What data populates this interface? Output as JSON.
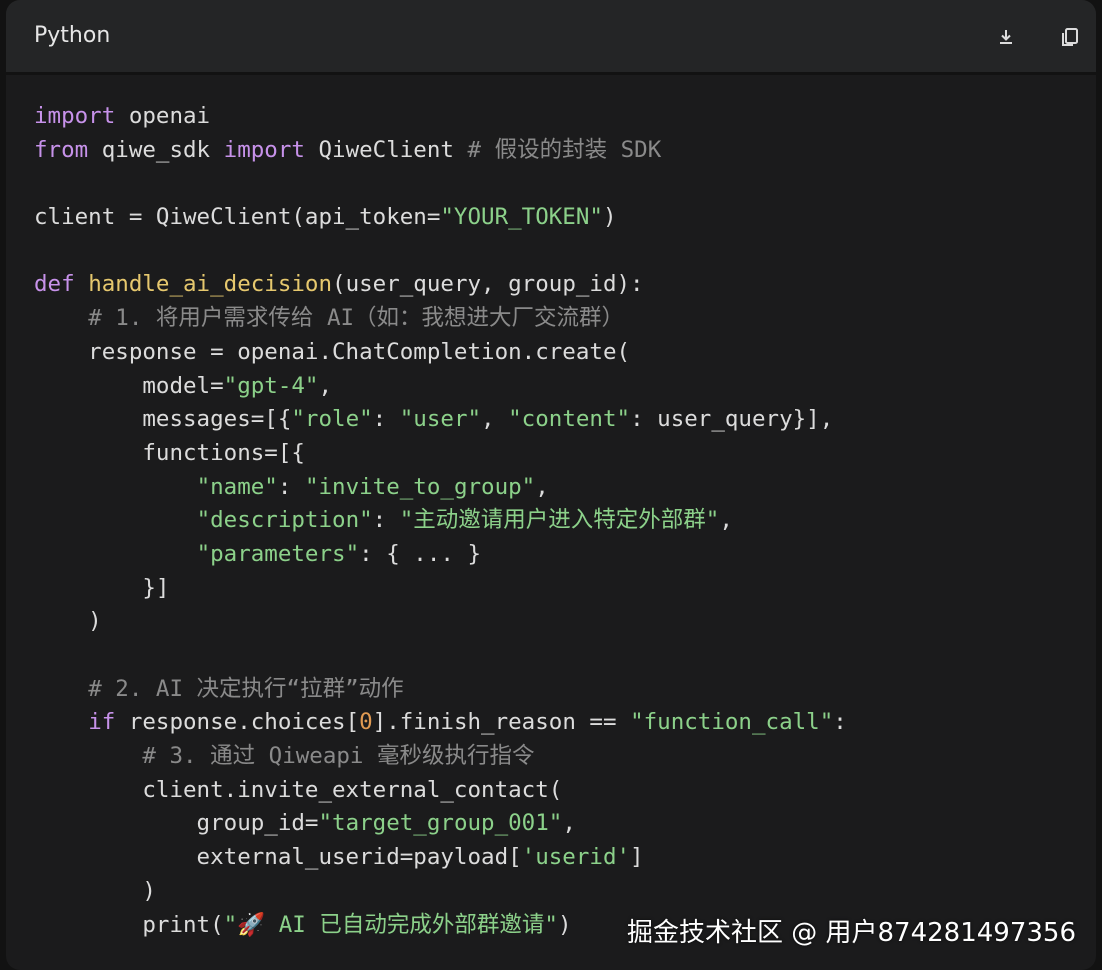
{
  "header": {
    "language": "Python",
    "download_icon": "download-icon",
    "copy_icon": "copy-icon"
  },
  "code_lines": [
    [
      {
        "c": "kw",
        "t": "import"
      },
      {
        "c": "pl",
        "t": " openai"
      }
    ],
    [
      {
        "c": "kw",
        "t": "from"
      },
      {
        "c": "pl",
        "t": " qiwe_sdk "
      },
      {
        "c": "kw",
        "t": "import"
      },
      {
        "c": "pl",
        "t": " QiweClient "
      },
      {
        "c": "cm",
        "t": "# 假设的封装 SDK"
      }
    ],
    [],
    [
      {
        "c": "pl",
        "t": "client = QiweClient(api_token="
      },
      {
        "c": "str",
        "t": "\"YOUR_TOKEN\""
      },
      {
        "c": "pl",
        "t": ")"
      }
    ],
    [],
    [
      {
        "c": "kw",
        "t": "def"
      },
      {
        "c": "pl",
        "t": " "
      },
      {
        "c": "fn",
        "t": "handle_ai_decision"
      },
      {
        "c": "pl",
        "t": "(user_query, group_id):"
      }
    ],
    [
      {
        "c": "pl",
        "t": "    "
      },
      {
        "c": "cm",
        "t": "# 1. 将用户需求传给 AI（如：我想进大厂交流群）"
      }
    ],
    [
      {
        "c": "pl",
        "t": "    response = openai.ChatCompletion.create("
      }
    ],
    [
      {
        "c": "pl",
        "t": "        model="
      },
      {
        "c": "str",
        "t": "\"gpt-4\""
      },
      {
        "c": "pl",
        "t": ","
      }
    ],
    [
      {
        "c": "pl",
        "t": "        messages=[{"
      },
      {
        "c": "str",
        "t": "\"role\""
      },
      {
        "c": "pl",
        "t": ": "
      },
      {
        "c": "str",
        "t": "\"user\""
      },
      {
        "c": "pl",
        "t": ", "
      },
      {
        "c": "str",
        "t": "\"content\""
      },
      {
        "c": "pl",
        "t": ": user_query}],"
      }
    ],
    [
      {
        "c": "pl",
        "t": "        functions=[{"
      }
    ],
    [
      {
        "c": "pl",
        "t": "            "
      },
      {
        "c": "str",
        "t": "\"name\""
      },
      {
        "c": "pl",
        "t": ": "
      },
      {
        "c": "str",
        "t": "\"invite_to_group\""
      },
      {
        "c": "pl",
        "t": ","
      }
    ],
    [
      {
        "c": "pl",
        "t": "            "
      },
      {
        "c": "str",
        "t": "\"description\""
      },
      {
        "c": "pl",
        "t": ": "
      },
      {
        "c": "str",
        "t": "\"主动邀请用户进入特定外部群\""
      },
      {
        "c": "pl",
        "t": ","
      }
    ],
    [
      {
        "c": "pl",
        "t": "            "
      },
      {
        "c": "str",
        "t": "\"parameters\""
      },
      {
        "c": "pl",
        "t": ": { ... }"
      }
    ],
    [
      {
        "c": "pl",
        "t": "        }]"
      }
    ],
    [
      {
        "c": "pl",
        "t": "    )"
      }
    ],
    [],
    [
      {
        "c": "pl",
        "t": "    "
      },
      {
        "c": "cm",
        "t": "# 2. AI 决定执行“拉群”动作"
      }
    ],
    [
      {
        "c": "pl",
        "t": "    "
      },
      {
        "c": "kw",
        "t": "if"
      },
      {
        "c": "pl",
        "t": " response.choices["
      },
      {
        "c": "num",
        "t": "0"
      },
      {
        "c": "pl",
        "t": "].finish_reason == "
      },
      {
        "c": "str",
        "t": "\"function_call\""
      },
      {
        "c": "pl",
        "t": ":"
      }
    ],
    [
      {
        "c": "pl",
        "t": "        "
      },
      {
        "c": "cm",
        "t": "# 3. 通过 Qiweapi 毫秒级执行指令"
      }
    ],
    [
      {
        "c": "pl",
        "t": "        client.invite_external_contact("
      }
    ],
    [
      {
        "c": "pl",
        "t": "            group_id="
      },
      {
        "c": "str",
        "t": "\"target_group_001\""
      },
      {
        "c": "pl",
        "t": ","
      }
    ],
    [
      {
        "c": "pl",
        "t": "            external_userid=payload["
      },
      {
        "c": "str",
        "t": "'userid'"
      },
      {
        "c": "pl",
        "t": "]"
      }
    ],
    [
      {
        "c": "pl",
        "t": "        )"
      }
    ],
    [
      {
        "c": "pl",
        "t": "        print("
      },
      {
        "c": "str",
        "t": "\"🚀 AI 已自动完成外部群邀请\""
      },
      {
        "c": "pl",
        "t": ")"
      }
    ]
  ],
  "watermark": "掘金技术社区 @ 用户874281497356"
}
